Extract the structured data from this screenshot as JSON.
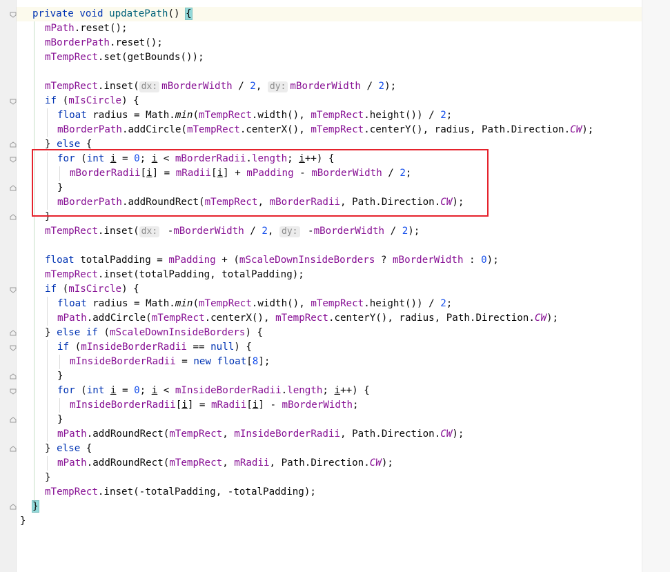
{
  "editor": {
    "method_name": "updatePath",
    "accent_highlight_color": "#e5222c",
    "lines": {
      "l1": {
        "priv": "private",
        "void": "void",
        "name": "updatePath",
        "paren": "() ",
        "brace": "{"
      },
      "l2": {
        "a": "mPath",
        "b": ".reset();"
      },
      "l3": {
        "a": "mBorderPath",
        "b": ".reset();"
      },
      "l4": {
        "a": "mTempRect",
        "b": ".set(getBounds());"
      },
      "l6": {
        "a": "mTempRect",
        "b": ".inset(",
        "h1": "dx:",
        "c": "mBorderWidth",
        "d": " / ",
        "e": "2",
        "f": ", ",
        "h2": "dy:",
        "g": "mBorderWidth",
        "i": " / ",
        "j": "2",
        "k": ");"
      },
      "l7": {
        "kw": "if",
        "a": " (",
        "b": "mIsCircle",
        "c": ") {"
      },
      "l8": {
        "kw": "float",
        "a": " radius = Math.",
        "b": "min",
        "c": "(",
        "d": "mTempRect",
        "e": ".width(), ",
        "f": "mTempRect",
        "g": ".height()) / ",
        "h": "2",
        "i": ";"
      },
      "l9": {
        "a": "mBorderPath",
        "b": ".addCircle(",
        "c": "mTempRect",
        "d": ".centerX(), ",
        "e": "mTempRect",
        "f": ".centerY(), radius, Path.Direction.",
        "g": "CW",
        "h": ");"
      },
      "l10": {
        "a": "} ",
        "kw": "else",
        "b": " {"
      },
      "l11": {
        "kw": "for",
        "a": " (",
        "kw2": "int",
        "b": " ",
        "i1": "i",
        "c": " = ",
        "n0": "0",
        "d": "; ",
        "i2": "i",
        "e": " < ",
        "f": "mBorderRadii",
        "g": ".",
        "h": "length",
        "j": "; ",
        "i3": "i",
        "k": "++) {"
      },
      "l12": {
        "a": "mBorderRadii",
        "b": "[",
        "i1": "i",
        "c": "] = ",
        "d": "mRadii",
        "e": "[",
        "i2": "i",
        "f": "] + ",
        "g": "mPadding",
        "h": " - ",
        "j": "mBorderWidth",
        "k": " / ",
        "n": "2",
        "m": ";"
      },
      "l13": {
        "a": "}"
      },
      "l14": {
        "a": "mBorderPath",
        "b": ".addRoundRect(",
        "c": "mTempRect",
        "d": ", ",
        "e": "mBorderRadii",
        "f": ", Path.Direction.",
        "g": "CW",
        "h": ");"
      },
      "l15": {
        "a": "}"
      },
      "l16": {
        "a": "mTempRect",
        "b": ".inset(",
        "h1": "dx:",
        "c": " -",
        "d": "mBorderWidth",
        "e": " / ",
        "f": "2",
        "g": ", ",
        "h2": "dy:",
        "i": " -",
        "j": "mBorderWidth",
        "k": " / ",
        "m": "2",
        "n": ");"
      },
      "l18": {
        "kw": "float",
        "a": " totalPadding = ",
        "b": "mPadding",
        "c": " + (",
        "d": "mScaleDownInsideBorders",
        "e": " ? ",
        "f": "mBorderWidth",
        "g": " : ",
        "h": "0",
        "i": ");"
      },
      "l19": {
        "a": "mTempRect",
        "b": ".inset(totalPadding, totalPadding);"
      },
      "l20": {
        "kw": "if",
        "a": " (",
        "b": "mIsCircle",
        "c": ") {"
      },
      "l21": {
        "kw": "float",
        "a": " radius = Math.",
        "b": "min",
        "c": "(",
        "d": "mTempRect",
        "e": ".width(), ",
        "f": "mTempRect",
        "g": ".height()) / ",
        "h": "2",
        "i": ";"
      },
      "l22": {
        "a": "mPath",
        "b": ".addCircle(",
        "c": "mTempRect",
        "d": ".centerX(), ",
        "e": "mTempRect",
        "f": ".centerY(), radius, Path.Direction.",
        "g": "CW",
        "h": ");"
      },
      "l23": {
        "a": "} ",
        "kw": "else if",
        "b": " (",
        "c": "mScaleDownInsideBorders",
        "d": ") {"
      },
      "l24": {
        "kw": "if",
        "a": " (",
        "b": "mInsideBorderRadii",
        "c": " == ",
        "kw2": "null",
        "d": ") {"
      },
      "l25": {
        "a": "mInsideBorderRadii",
        "b": " = ",
        "kw": "new float",
        "c": "[",
        "n": "8",
        "d": "];"
      },
      "l26": {
        "a": "}"
      },
      "l27": {
        "kw": "for",
        "a": " (",
        "kw2": "int",
        "b": " ",
        "i1": "i",
        "c": " = ",
        "n0": "0",
        "d": "; ",
        "i2": "i",
        "e": " < ",
        "f": "mInsideBorderRadii",
        "g": ".",
        "h": "length",
        "j": "; ",
        "i3": "i",
        "k": "++) {"
      },
      "l28": {
        "a": "mInsideBorderRadii",
        "b": "[",
        "i1": "i",
        "c": "] = ",
        "d": "mRadii",
        "e": "[",
        "i2": "i",
        "f": "] - ",
        "g": "mBorderWidth",
        "h": ";"
      },
      "l29": {
        "a": "}"
      },
      "l30": {
        "a": "mPath",
        "b": ".addRoundRect(",
        "c": "mTempRect",
        "d": ", ",
        "e": "mInsideBorderRadii",
        "f": ", Path.Direction.",
        "g": "CW",
        "h": ");"
      },
      "l31": {
        "a": "} ",
        "kw": "else",
        "b": " {"
      },
      "l32": {
        "a": "mPath",
        "b": ".addRoundRect(",
        "c": "mTempRect",
        "d": ", ",
        "e": "mRadii",
        "f": ", Path.Direction.",
        "g": "CW",
        "h": ");"
      },
      "l33": {
        "a": "}"
      },
      "l34": {
        "a": "mTempRect",
        "b": ".inset(-totalPadding, -totalPadding);"
      },
      "l35": {
        "a": "}"
      },
      "l36": {
        "a": "}"
      }
    }
  }
}
